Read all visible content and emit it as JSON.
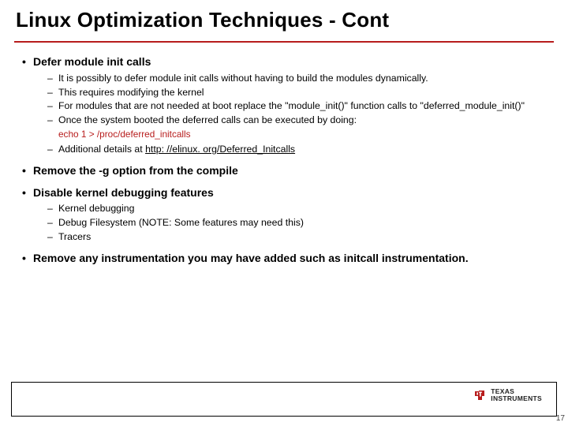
{
  "title": "Linux Optimization Techniques - Cont",
  "bullets": [
    {
      "text": "Defer module init calls",
      "sub": [
        "It is possibly to defer module init calls without having to build the modules dynamically.",
        "This requires modifying the kernel",
        "For modules that are not needed at boot replace the \"module_init()\" function calls to \"deferred_module_init()\"",
        "Once the system booted the deferred calls can be executed by doing:"
      ],
      "code": "echo 1 > /proc/deferred_initcalls",
      "sub_after": [
        {
          "prefix": "Additional details at ",
          "link": "http: //elinux. org/Deferred_Initcalls"
        }
      ]
    },
    {
      "text": "Remove the -g option from the compile",
      "sub": []
    },
    {
      "text": "Disable kernel debugging features",
      "sub": [
        "Kernel debugging",
        "Debug Filesystem (NOTE: Some features may need this)",
        "Tracers"
      ]
    },
    {
      "text": "Remove any instrumentation you may have added such as initcall instrumentation.",
      "sub": []
    }
  ],
  "logo": {
    "line1": "TEXAS",
    "line2": "INSTRUMENTS"
  },
  "page_number": "17"
}
